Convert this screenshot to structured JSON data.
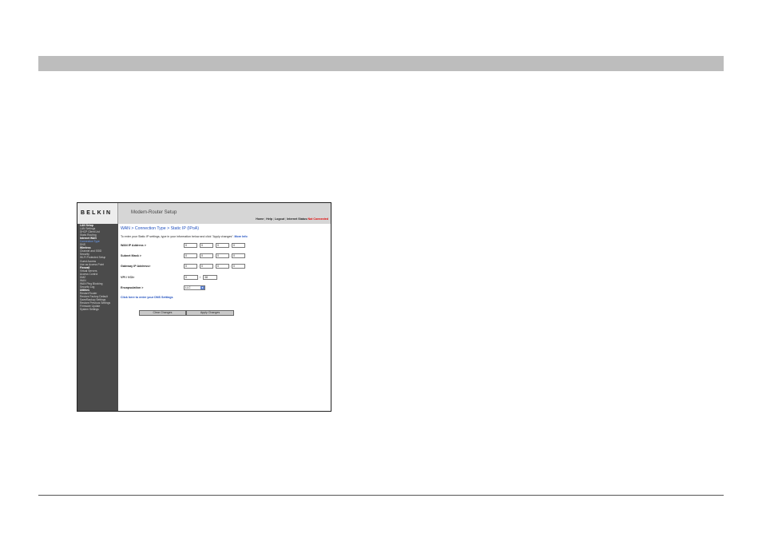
{
  "router": {
    "brand": "BELKIN",
    "title": "Modem-Router Setup",
    "top_nav": {
      "home": "Home",
      "help": "Help",
      "logout": "Logout",
      "status_label": "Internet Status:",
      "status_value": "Not Connected",
      "sep": "|"
    },
    "sidebar": [
      {
        "label": "LAN Setup",
        "section": true
      },
      {
        "label": "LAN Settings"
      },
      {
        "label": "DHCP Client List"
      },
      {
        "label": "Static Routing"
      },
      {
        "label": "Internet WAN",
        "section": true
      },
      {
        "label": "Connection Type",
        "current": true
      },
      {
        "label": "DNS"
      },
      {
        "label": "Wireless",
        "section": true
      },
      {
        "label": "Channel and SSID"
      },
      {
        "label": "Security"
      },
      {
        "label": "Wi-Fi Protected Setup"
      },
      {
        "label": "Guest Access"
      },
      {
        "label": "Use as Access Point"
      },
      {
        "label": "Firewall",
        "section": true
      },
      {
        "label": "Virtual Servers"
      },
      {
        "label": "Access Control"
      },
      {
        "label": "DMZ"
      },
      {
        "label": "WAN"
      },
      {
        "label": "WAN Ping Blocking"
      },
      {
        "label": "Security Log"
      },
      {
        "label": "Utilities",
        "section": true
      },
      {
        "label": "Restart Router"
      },
      {
        "label": "Restore Factory Default"
      },
      {
        "label": "Save/Backup Settings"
      },
      {
        "label": "Restore Previous Settings"
      },
      {
        "label": "Firmware Update"
      },
      {
        "label": "System Settings"
      }
    ],
    "breadcrumb": "WAN > Connection Type > Static IP (IPoA)",
    "intro": "To enter your Static IP settings, type in your information below and click \"Apply changes\".",
    "more_info": "More Info",
    "wan_ip_label": "WAN IP Address >",
    "wan_ip": [
      "0",
      "0",
      "0",
      "0"
    ],
    "subnet_label": "Subnet Mask >",
    "subnet": [
      "0",
      "0",
      "0",
      "0"
    ],
    "gateway_label": "Gateway IP Address>",
    "gateway": [
      "0",
      "0",
      "0",
      "0"
    ],
    "vpi_vci_label": "VPI / VCI>",
    "vpi": "0",
    "vci": "38",
    "encap_label": "Encapsulation >",
    "encap_value": "LLC",
    "dns_link": "Click here to enter your DNS Settings",
    "clear_button": "Clear Changes",
    "apply_button": "Apply Changes"
  },
  "colors": {
    "banner": "#bdbdbd",
    "sidebar_bg": "#4b4b4b",
    "link_blue": "#1f4fbf",
    "not_connected_red": "#e00000"
  }
}
